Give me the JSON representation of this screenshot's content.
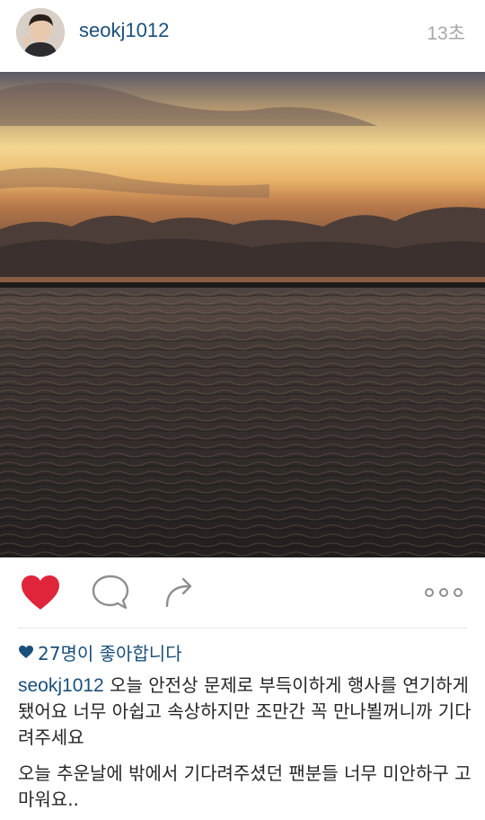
{
  "post": {
    "username": "seokj1012",
    "timestamp": "13초"
  },
  "photo": {
    "description_icon": "sunset-over-sea-photo"
  },
  "actions": {
    "like_icon": "heart-filled-icon",
    "comment_icon": "comment-bubble-icon",
    "share_icon": "share-arrow-icon",
    "more_icon": "more-dots-icon",
    "like_color": "#e0253a"
  },
  "likes": {
    "text": "27명이 좋아합니다"
  },
  "caption": {
    "username": "seokj1012",
    "text": " 오늘 안전상 문제로 부득이하게 행사를 연기하게됐어요 너무 아쉽고 속상하지만 조만간 꼭 만나뵐꺼니까 기다려주세요"
  },
  "comment": {
    "text": "오늘 추운날에 밖에서 기다려주셨던 팬분들 너무 미안하구 고마워요.."
  },
  "colors": {
    "link": "#1a4f7a",
    "muted": "#a8a8a8"
  }
}
